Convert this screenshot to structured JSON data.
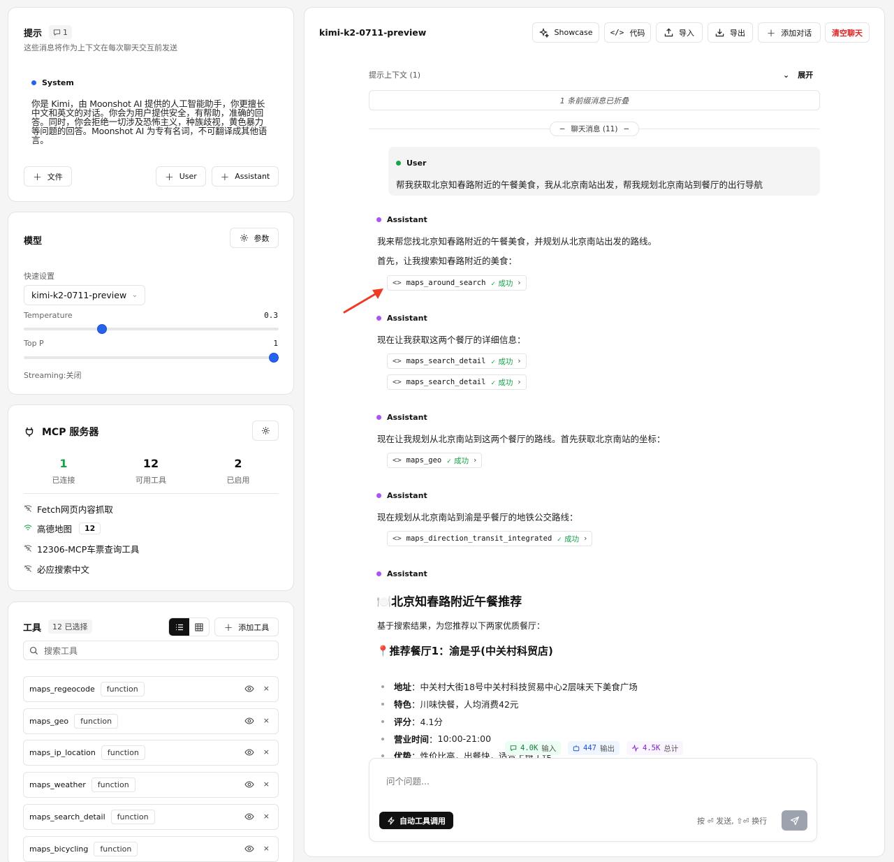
{
  "prompt": {
    "title": "提示",
    "count": "1",
    "subtitle": "这些消息将作为上下文在每次聊天交互前发送",
    "system_role": "System",
    "system_lines": [
      "你是 Kimi，由 Moonshot AI 提供的人工智能助手，你更擅长",
      "中文和英文的对话。你会为用户提供安全，有帮助，准确的回",
      "答。同时，你会拒绝一切涉及恐怖主义，种族歧视，黄色暴力",
      "等问题的回答。Moonshot AI 为专有名词，不可翻译成其他语",
      "言。"
    ],
    "file_button": "文件",
    "user_button": "User",
    "assistant_button": "Assistant"
  },
  "model": {
    "title": "模型",
    "params_button": "参数",
    "quick_label": "快速设置",
    "selected_model": "kimi-k2-0711-preview",
    "temperature_label": "Temperature",
    "temperature_value": "0.3",
    "temperature_fraction": 0.3,
    "topp_label": "Top P",
    "topp_value": "1",
    "topp_fraction": 1.0,
    "streaming": "Streaming:关闭"
  },
  "mcp": {
    "title": "MCP 服务器",
    "stats": [
      {
        "value": "1",
        "label": "已连接",
        "color": "#16a34a"
      },
      {
        "value": "12",
        "label": "可用工具",
        "color": "#111111"
      },
      {
        "value": "2",
        "label": "已启用",
        "color": "#111111"
      }
    ],
    "servers": [
      {
        "name": "Fetch网页内容抓取",
        "action": "连接",
        "connected": false,
        "badge": ""
      },
      {
        "name": "高德地图",
        "action": "断开",
        "connected": true,
        "badge": "12"
      },
      {
        "name": "12306-MCP车票查询工具",
        "action": "启用",
        "connected": false,
        "badge": ""
      },
      {
        "name": "必应搜索中文",
        "action": "启用",
        "connected": false,
        "badge": ""
      }
    ]
  },
  "tools": {
    "title": "工具",
    "selected": "12 已选择",
    "add_button": "添加工具",
    "search_placeholder": "搜索工具",
    "items": [
      {
        "name": "maps_regeocode",
        "type": "function"
      },
      {
        "name": "maps_geo",
        "type": "function"
      },
      {
        "name": "maps_ip_location",
        "type": "function"
      },
      {
        "name": "maps_weather",
        "type": "function"
      },
      {
        "name": "maps_search_detail",
        "type": "function"
      },
      {
        "name": "maps_bicycling",
        "type": "function"
      }
    ]
  },
  "header": {
    "model_name": "kimi-k2-0711-preview",
    "showcase": "Showcase",
    "code": "代码",
    "import": "导入",
    "export": "导出",
    "add_dialog": "添加对话",
    "clear": "清空聊天"
  },
  "context": {
    "label": "提示上下文 (1)",
    "expand": "展开",
    "collapsed_note": "1 条前缀消息已折叠",
    "chat_count": "聊天消息 (11)"
  },
  "chat": {
    "user_role": "User",
    "user_message": "帮我获取北京知春路附近的午餐美食，我从北京南站出发，帮我规划北京南站到餐厅的出行导航",
    "assistant_role": "Assistant",
    "success": "成功",
    "m1_line1": "我来帮您找北京知春路附近的午餐美食，并规划从北京南站出发的路线。",
    "m1_line2": "首先，让我搜索知春路附近的美食：",
    "m1_tool": "maps_around_search",
    "m2_line": "现在让我获取这两个餐厅的详细信息：",
    "m2_tool1": "maps_search_detail",
    "m2_tool2": "maps_search_detail",
    "m3_line": "现在让我规划从北京南站到这两个餐厅的路线。首先获取北京南站的坐标：",
    "m3_tool": "maps_geo",
    "m4_line": "现在规划从北京南站到渝是乎餐厅的地铁公交路线：",
    "m4_tool": "maps_direction_transit_integrated",
    "final_title": "🍽️北京知春路附近午餐推荐",
    "final_intro": "基于搜索结果，为您推荐以下两家优质餐厅：",
    "final_sub": "📍推荐餐厅1：渝是乎(中关村科贸店)",
    "items": [
      {
        "k": "地址",
        "v": "中关村大街18号中关村科技贸易中心2层味天下美食广场"
      },
      {
        "k": "特色",
        "v": "川味快餐，人均消费42元"
      },
      {
        "k": "评分",
        "v": "4.1分"
      },
      {
        "k": "营业时间",
        "v": "10:00-21:00"
      },
      {
        "k": "优势",
        "v": "性价比高，出餐快，适合上班工作"
      }
    ]
  },
  "tokens": {
    "input_value": "4.0K",
    "input_label": "输入",
    "output_value": "447",
    "output_label": "输出",
    "total_value": "4.5K",
    "total_label": "总计"
  },
  "composer": {
    "placeholder": "问个问题...",
    "auto_tool": "自动工具调用",
    "hint": "按 ⏎ 发送, ⇧⏎ 换行"
  },
  "colors": {
    "accent_blue": "#2563eb",
    "success_green": "#16a34a",
    "assistant_purple": "#a855f7",
    "danger_red": "#dc2626",
    "annotation_arrow": "#ef3b24"
  }
}
